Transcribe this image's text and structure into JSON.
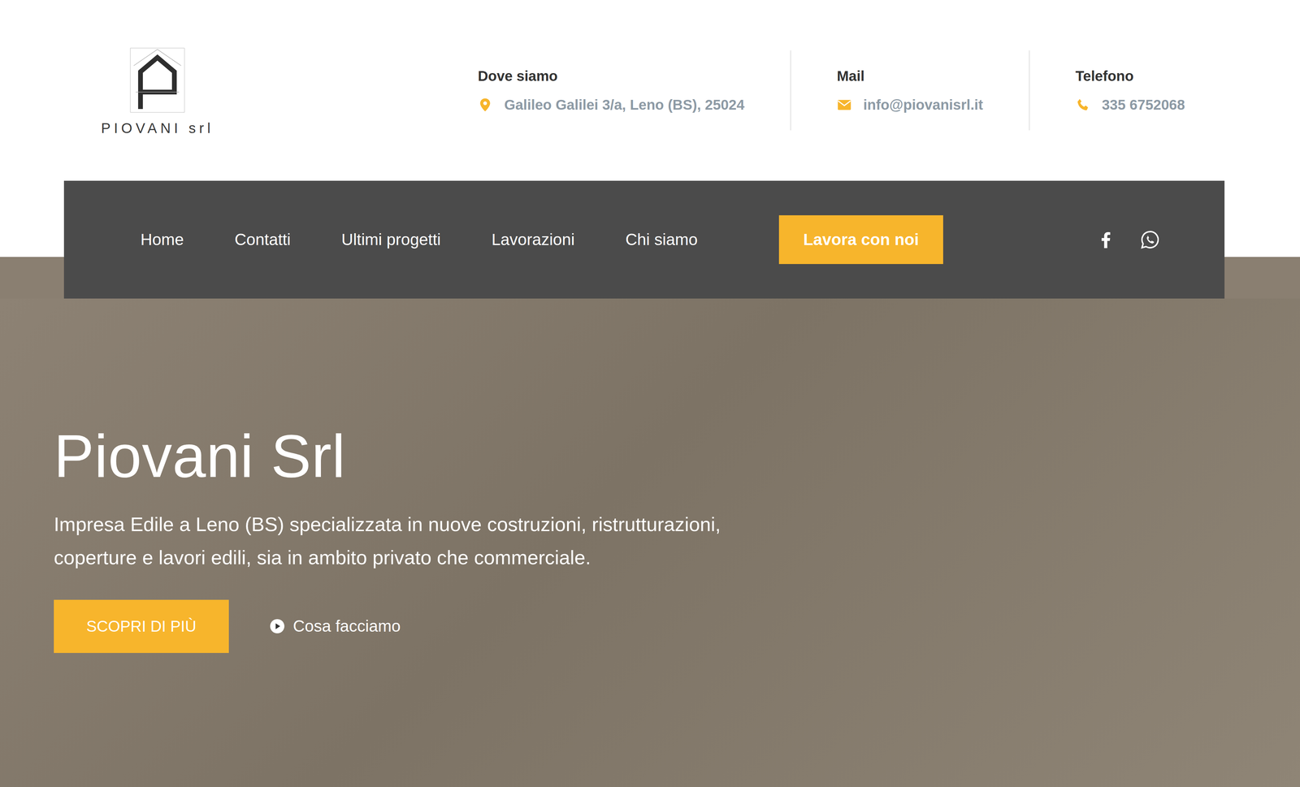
{
  "logo": {
    "text": "PIOVANI srl"
  },
  "contacts": [
    {
      "kind": "address",
      "label": "Dove siamo",
      "value": "Galileo Galilei 3/a, Leno (BS), 25024"
    },
    {
      "kind": "mail",
      "label": "Mail",
      "value": "info@piovanisrl.it"
    },
    {
      "kind": "phone",
      "label": "Telefono",
      "value": "335 6752068"
    }
  ],
  "nav": {
    "items": [
      "Home",
      "Contatti",
      "Ultimi progetti",
      "Lavorazioni",
      "Chi siamo"
    ],
    "cta": "Lavora con noi",
    "social": [
      {
        "kind": "facebook"
      },
      {
        "kind": "whatsapp"
      }
    ]
  },
  "hero": {
    "title": "Piovani Srl",
    "description": "Impresa Edile a Leno (BS) specializzata in nuove costruzioni, ristrutturazioni, coperture e lavori edili, sia in ambito privato che commerciale.",
    "primary_button": "SCOPRI DI PIÙ",
    "secondary_button": "Cosa facciamo"
  }
}
